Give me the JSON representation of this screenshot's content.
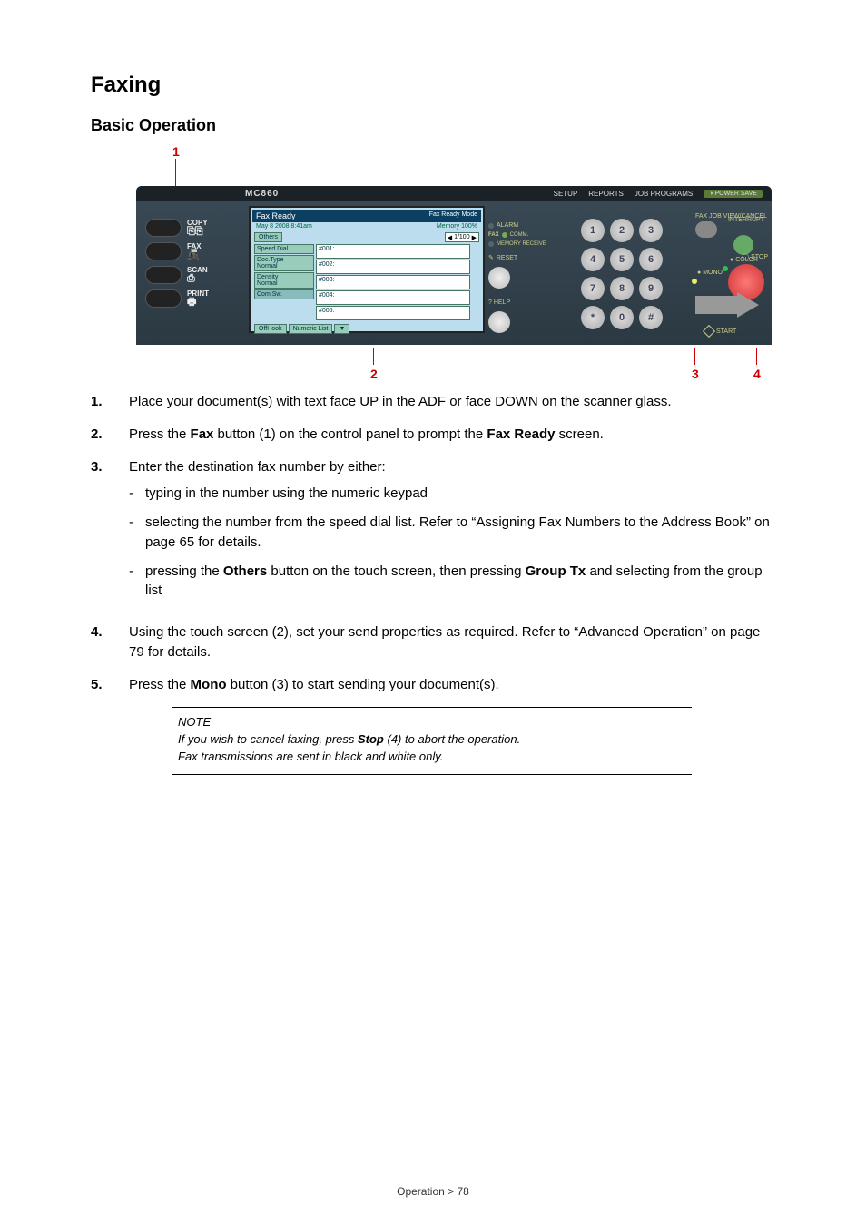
{
  "title": "Faxing",
  "subtitle": "Basic Operation",
  "callouts": {
    "top": "1",
    "bottom": [
      "2",
      "3",
      "4"
    ]
  },
  "panel": {
    "brand": "MC860",
    "top": {
      "setup": "SETUP",
      "reports": "REPORTS",
      "job_programs": "JOB PROGRAMS",
      "power_save": "POWER SAVE"
    },
    "modes": {
      "copy": "COPY",
      "fax": "FAX",
      "scan": "SCAN",
      "print": "PRINT"
    },
    "screen": {
      "header_left": "Fax Ready",
      "header_right": "Fax Ready Mode",
      "date": "May  8 2008  8:41am",
      "memory_label": "Memory",
      "memory_value": "100%",
      "others_btn": "Others",
      "pager": "1/100",
      "left_buttons": [
        "Speed Dial",
        "Doc.Type\nNormal",
        "Density\nNormal",
        "Com.Sw."
      ],
      "dials": [
        "#001:",
        "#002:",
        "#003:",
        "#004:",
        "#005:"
      ],
      "offhook": "OffHook",
      "numeric_list": "Numeric List"
    },
    "mid": {
      "alarm": "ALARM",
      "fax": "FAX",
      "comm": "COMM.",
      "memory_receive": "MEMORY RECEIVE",
      "reset": "RESET",
      "help": "? HELP"
    },
    "keypad": [
      "1",
      "2",
      "3",
      "4",
      "5",
      "6",
      "7",
      "8",
      "9",
      "*",
      "0",
      "#"
    ],
    "right": {
      "faxjob": "FAX JOB VIEW/CANCEL",
      "interrupt": "INTERRUPT",
      "stop": "STOP",
      "color": "COLOR",
      "mono": "MONO",
      "start": "START"
    }
  },
  "steps": [
    {
      "text_parts": [
        "Place your document(s) with text face UP in the ADF or face DOWN on the scanner glass."
      ]
    },
    {
      "text_parts": [
        "Press the ",
        {
          "b": "Fax"
        },
        " button (1) on the control panel to prompt the ",
        {
          "b": "Fax Ready"
        },
        " screen."
      ]
    },
    {
      "text_parts": [
        "Enter the destination fax number by either:"
      ],
      "sub": [
        "typing in the number using the numeric keypad",
        "selecting the number from the speed dial list. Refer to “Assigning Fax Numbers to the Address Book” on page 65 for details.",
        {
          "parts": [
            "pressing the ",
            {
              "b": "Others"
            },
            " button on the touch screen, then pressing ",
            {
              "b": "Group Tx"
            },
            " and selecting from the group list"
          ]
        }
      ]
    },
    {
      "text_parts": [
        "Using the touch screen (2), set your send properties as required. Refer to “Advanced Operation” on page 79 for details."
      ]
    },
    {
      "text_parts": [
        "Press the ",
        {
          "b": "Mono"
        },
        " button (3) to start sending your document(s)."
      ]
    }
  ],
  "note": {
    "title": "NOTE",
    "lines": [
      {
        "parts": [
          "If you wish to cancel faxing, press ",
          {
            "b": "Stop"
          },
          " (4) to abort the operation."
        ]
      },
      {
        "parts": [
          "Fax transmissions are sent in black and white only."
        ]
      }
    ]
  },
  "footer": "Operation > 78"
}
